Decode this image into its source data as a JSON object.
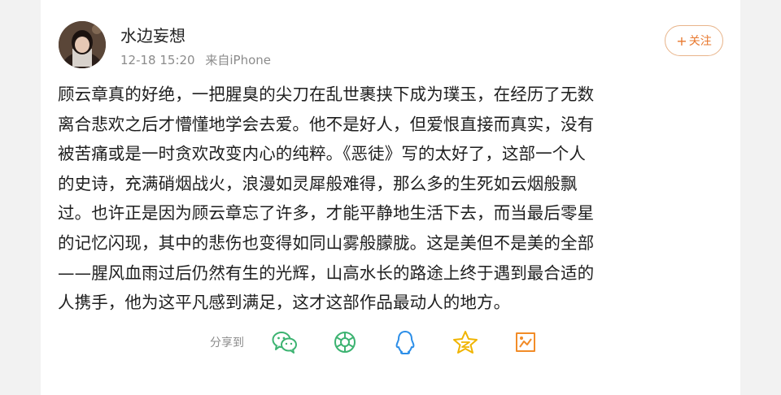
{
  "user": {
    "name": "水边妄想",
    "time": "12-18 15:20",
    "source": "来自iPhone"
  },
  "follow_button": {
    "plus": "+",
    "label": "关注"
  },
  "post": {
    "text": "顾云章真的好绝，一把腥臭的尖刀在乱世裹挟下成为璞玉，在经历了无数\n离合悲欢之后才懵懂地学会去爱。他不是好人，但爱恨直接而真实，没有\n被苦痛或是一时贪欢改变内心的纯粹。《恶徒》写的太好了，这部一个人\n的史诗，充满硝烟战火，浪漫如灵犀般难得，那么多的生死如云烟般飘\n过。也许正是因为顾云章忘了许多，才能平静地生活下去，而当最后零星\n的记忆闪现，其中的悲伤也变得如同山雾般朦胧。这是美但不是美的全部\n——腥风血雨过后仍然有生的光辉，山高水长的路途上终于遇到最合适的\n人携手，他为这平凡感到满足，这才这部作品最动人的地方。"
  },
  "share": {
    "label": "分享到",
    "icons": [
      "wechat-icon",
      "moments-icon",
      "qq-icon",
      "qzone-icon",
      "weibo-share-icon"
    ]
  },
  "colors": {
    "accent": "#e8782e",
    "icon_green": "#3cb371",
    "icon_blue": "#2c8ee8",
    "icon_yellow": "#f0b400",
    "icon_orange": "#f28c28"
  }
}
